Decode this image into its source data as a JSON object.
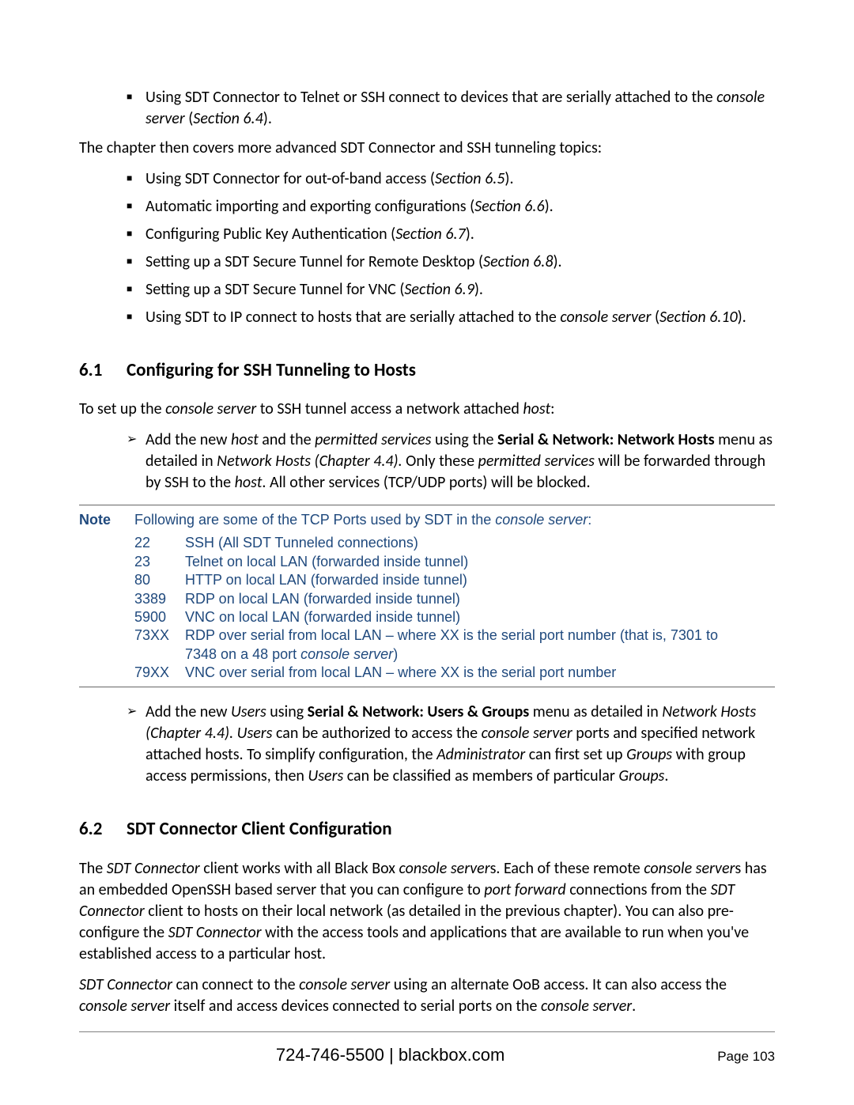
{
  "intro_bullet": {
    "pre": "Using SDT Connector to Telnet or SSH connect to devices that are serially attached to the ",
    "ital1": "console server",
    "mid": " (",
    "ital2": "Section 6.4",
    "post": ")."
  },
  "intro_para": "The chapter then covers more advanced SDT Connector and SSH tunneling topics:",
  "bullets": [
    {
      "pre": "Using SDT Connector for out-of-band access (",
      "ital": "Section 6.5",
      "post": ")."
    },
    {
      "pre": "Automatic importing and exporting configurations (",
      "ital": "Section 6.6",
      "post": ")."
    },
    {
      "pre": "Configuring Public Key Authentication (",
      "ital": "Section 6.7",
      "post": ")."
    },
    {
      "pre": "Setting up a SDT Secure Tunnel for Remote Desktop (",
      "ital": "Section 6.8",
      "post": ")."
    },
    {
      "pre": "Setting up a SDT Secure Tunnel for VNC (",
      "ital": "Section 6.9",
      "post": ")."
    }
  ],
  "bullet_last": {
    "pre": "Using SDT to IP connect to hosts that are serially attached to the ",
    "ital1": "console server",
    "mid": " (",
    "ital2": "Section 6.10",
    "post": ")."
  },
  "sec61": {
    "num": "6.1",
    "title": "Configuring for SSH Tunneling to Hosts",
    "para": {
      "p0": "To set up the ",
      "i1": "console server",
      "p1": " to SSH tunnel access a network attached ",
      "i2": "host",
      "p2": ":"
    },
    "arrow1": {
      "a0": "Add the new ",
      "i1": "host",
      "a1": " and the ",
      "i2": "permitted services",
      "a2": " using the ",
      "b1": "Serial & Network: Network Hosts",
      "a3": " menu as detailed in ",
      "i3": "Network Hosts (Chapter 4.4).",
      "a4": " Only these ",
      "i4": "permitted services",
      "a5": " will be forwarded through by SSH to the ",
      "i5": "host",
      "a6": ". All other services (TCP/UDP ports) will be blocked."
    },
    "arrow2": {
      "a0": "Add the new ",
      "i1": "Users",
      "a1": " using ",
      "b1": "Serial & Network: Users & Groups",
      "a2": " menu as detailed in ",
      "i2": "Network Hosts (Chapter 4.4). Users",
      "a3": " can be authorized to access the ",
      "i3": "console server",
      "a4": " ports and specified network attached hosts. To simplify configuration, the ",
      "i4": "Administrator",
      "a5": " can first set up ",
      "i5": "Groups",
      "a6": " with group access permissions, then ",
      "i6": "Users",
      "a7": " can be classified as members of particular ",
      "i7": "Groups",
      "a8": "."
    }
  },
  "note": {
    "label": "Note",
    "intro_pre": "Following are some of the TCP Ports used by SDT in the ",
    "intro_ital": "console server",
    "intro_post": ":",
    "ports": [
      {
        "num": "22",
        "desc": "SSH (All SDT Tunneled connections)"
      },
      {
        "num": "23",
        "desc": "Telnet on local LAN (forwarded inside tunnel)"
      },
      {
        "num": "80",
        "desc": "HTTP on local LAN (forwarded inside tunnel)"
      },
      {
        "num": "3389",
        "desc": "RDP on local LAN (forwarded inside tunnel)"
      },
      {
        "num": "5900",
        "desc": "VNC on local LAN (forwarded inside tunnel)"
      }
    ],
    "port73": {
      "num": "73XX",
      "line1": "RDP over serial from local LAN – where XX is the serial port number (that is, 7301 to",
      "line2_pre": "7348 on a 48 port ",
      "line2_ital": "console server",
      "line2_post": ")"
    },
    "port79": {
      "num": "79XX",
      "desc": "VNC over serial from local LAN – where XX is the serial port number"
    }
  },
  "sec62": {
    "num": "6.2",
    "title": "SDT Connector Client Configuration",
    "para1": {
      "p0": "The ",
      "i1": "SDT Connector",
      "p1": " client works with all Black Box ",
      "i2": "console server",
      "p2": "s. Each of these remote ",
      "i3": "console server",
      "p3": "s has an embedded OpenSSH based server that you can configure to ",
      "i4": "port forward",
      "p4": " connections from the ",
      "i5": "SDT Connector",
      "p5": " client to hosts on their local network (as detailed in the previous chapter). You can also pre-configure the ",
      "i6": "SDT Connector",
      "p6": " with the access tools and applications that are available to run when you've established access to a particular host."
    },
    "para2": {
      "i1": "SDT Connector",
      "p1": " can connect to the ",
      "i2": "console server",
      "p2": " using an alternate OoB access. It can also access the ",
      "i3": "console server",
      "p3": " itself and access devices connected to serial ports on the ",
      "i4": "console server",
      "p4": "."
    }
  },
  "footer": {
    "center": "724-746-5500 | blackbox.com",
    "right": "Page 103"
  }
}
